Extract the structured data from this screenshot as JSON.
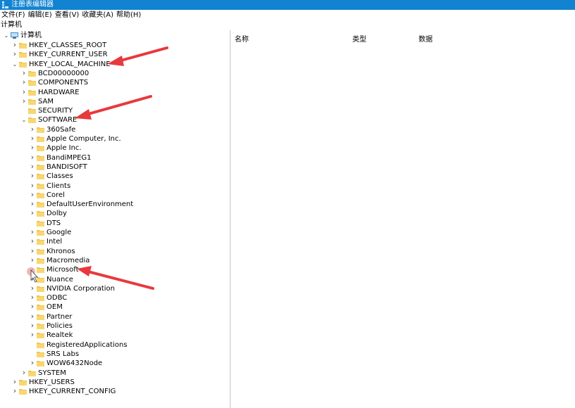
{
  "window": {
    "title": "注册表编辑器"
  },
  "menu": [
    "文件(F)",
    "编辑(E)",
    "查看(V)",
    "收藏夹(A)",
    "帮助(H)"
  ],
  "address": "计算机",
  "columns": {
    "name": "名称",
    "type": "类型",
    "data": "数据"
  },
  "tree": {
    "root": "计算机",
    "hives": [
      "HKEY_CLASSES_ROOT",
      "HKEY_CURRENT_USER",
      "HKEY_LOCAL_MACHINE",
      "HKEY_USERS",
      "HKEY_CURRENT_CONFIG"
    ],
    "hklm": [
      "BCD00000000",
      "COMPONENTS",
      "HARDWARE",
      "SAM",
      "SECURITY",
      "SOFTWARE",
      "SYSTEM"
    ],
    "software": [
      "360Safe",
      "Apple Computer, Inc.",
      "Apple Inc.",
      "BandiMPEG1",
      "BANDISOFT",
      "Classes",
      "Clients",
      "Corel",
      "DefaultUserEnvironment",
      "Dolby",
      "DTS",
      "Google",
      "Intel",
      "Khronos",
      "Macromedia",
      "Microsoft",
      "Nuance",
      "NVIDIA Corporation",
      "ODBC",
      "OEM",
      "Partner",
      "Policies",
      "Realtek",
      "RegisteredApplications",
      "SRS Labs",
      "WOW6432Node"
    ]
  },
  "colors": {
    "titlebar": "#1183d1",
    "folder": "#f3c54b",
    "annotation_arrow": "#e8393d"
  }
}
